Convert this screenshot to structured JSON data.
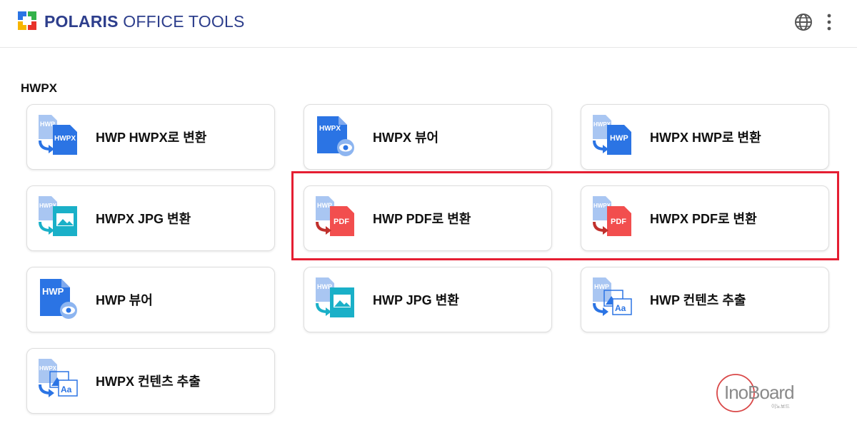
{
  "header": {
    "brand_bold": "POLARIS",
    "brand_rest": " OFFICE TOOLS",
    "colors": {
      "brand": "#2d3e8c"
    }
  },
  "section": {
    "title": "HWPX"
  },
  "tools": [
    {
      "label": "HWP HWPX로 변환",
      "icon": "hwp-to-hwpx-convert-icon"
    },
    {
      "label": "HWPX 뷰어",
      "icon": "hwpx-viewer-icon"
    },
    {
      "label": "HWPX HWP로 변환",
      "icon": "hwpx-to-hwp-convert-icon"
    },
    {
      "label": "HWPX JPG 변환",
      "icon": "hwpx-to-jpg-icon"
    },
    {
      "label": "HWP PDF로 변환",
      "icon": "hwp-to-pdf-icon"
    },
    {
      "label": "HWPX PDF로 변환",
      "icon": "hwpx-to-pdf-icon"
    },
    {
      "label": "HWP 뷰어",
      "icon": "hwp-viewer-icon"
    },
    {
      "label": "HWP JPG 변환",
      "icon": "hwp-to-jpg-icon"
    },
    {
      "label": "HWP 컨텐츠 추출",
      "icon": "hwp-content-extract-icon"
    },
    {
      "label": "HWPX 컨텐츠 추출",
      "icon": "hwpx-content-extract-icon"
    }
  ],
  "icon_text": {
    "hwp": "HWP",
    "hwpx": "HWPX",
    "pdf": "PDF",
    "aa": "Aa"
  },
  "watermark": {
    "text": "InoBoard",
    "subtext": "이노보드"
  },
  "colors": {
    "doc_blue": "#2b74e4",
    "doc_light": "#a9c6f2",
    "pdf_red": "#f24e4e",
    "jpg_teal": "#1ab0c8",
    "highlight_red": "#e51e32"
  }
}
